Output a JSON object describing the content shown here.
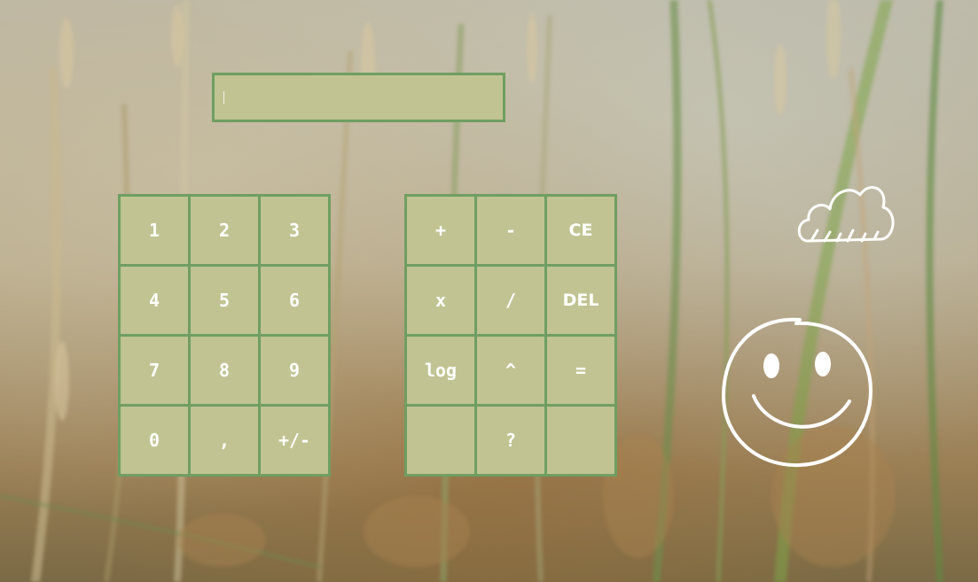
{
  "display": {
    "value": ""
  },
  "number_pad": [
    {
      "label": "1",
      "name": "key-1"
    },
    {
      "label": "2",
      "name": "key-2"
    },
    {
      "label": "3",
      "name": "key-3"
    },
    {
      "label": "4",
      "name": "key-4"
    },
    {
      "label": "5",
      "name": "key-5"
    },
    {
      "label": "6",
      "name": "key-6"
    },
    {
      "label": "7",
      "name": "key-7"
    },
    {
      "label": "8",
      "name": "key-8"
    },
    {
      "label": "9",
      "name": "key-9"
    },
    {
      "label": "0",
      "name": "key-0"
    },
    {
      "label": ",",
      "name": "key-comma"
    },
    {
      "label": "+/-",
      "name": "key-sign-toggle"
    }
  ],
  "operator_pad": [
    {
      "label": "+",
      "name": "key-plus"
    },
    {
      "label": "-",
      "name": "key-minus"
    },
    {
      "label": "CE",
      "name": "key-clear-entry"
    },
    {
      "label": "x",
      "name": "key-multiply"
    },
    {
      "label": "/",
      "name": "key-divide"
    },
    {
      "label": "DEL",
      "name": "key-delete"
    },
    {
      "label": "log",
      "name": "key-log"
    },
    {
      "label": "^",
      "name": "key-power"
    },
    {
      "label": "=",
      "name": "key-equals"
    },
    {
      "label": "",
      "name": "key-blank-1"
    },
    {
      "label": "?",
      "name": "key-help"
    },
    {
      "label": "",
      "name": "key-blank-2"
    }
  ],
  "decorations": {
    "cloud_icon": "cloud-icon",
    "smiley_icon": "smiley-face-icon"
  },
  "colors": {
    "key_fill": "#c1c392",
    "key_border": "#6f9e62",
    "key_text": "#ffffff"
  }
}
